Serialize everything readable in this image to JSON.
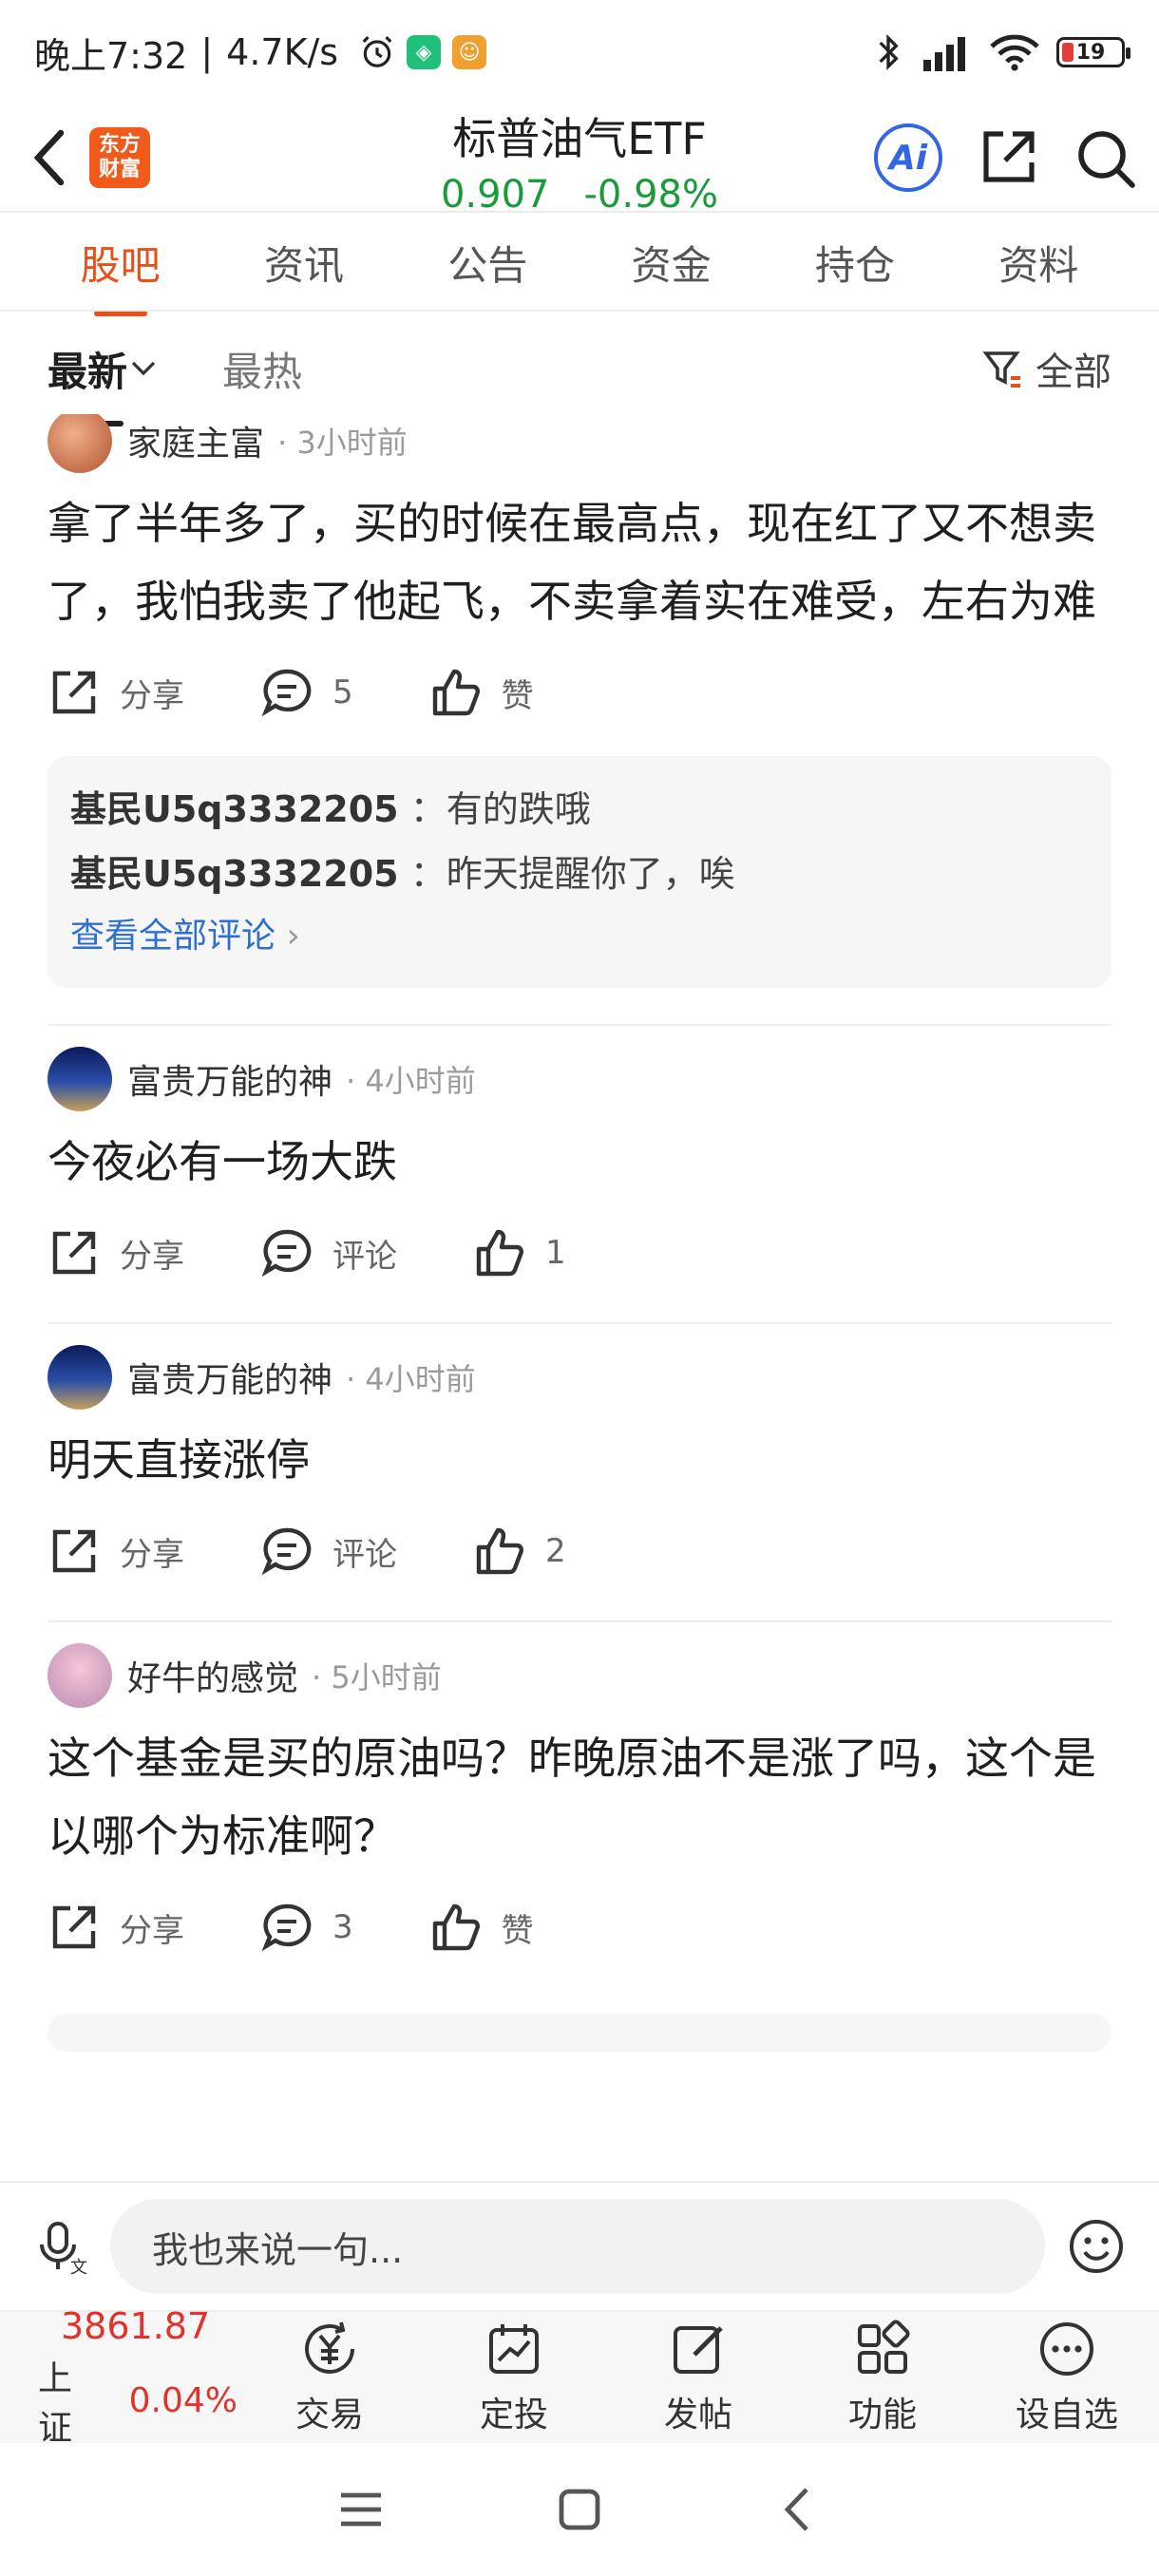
{
  "status_bar": {
    "time": "晚上7:32",
    "speed": "4.7K/s",
    "battery": "19"
  },
  "header": {
    "logo_line1": "东方",
    "logo_line2": "财富",
    "title": "标普油气ETF",
    "price": "0.907",
    "change": "-0.98%",
    "ai_label": "Ai"
  },
  "tabs": [
    "股吧",
    "资讯",
    "公告",
    "资金",
    "持仓",
    "资料"
  ],
  "filter": {
    "latest": "最新",
    "hottest": "最热",
    "all": "全部"
  },
  "posts": [
    {
      "user": "家庭主富",
      "time": "3小时前",
      "body": "拿了半年多了，买的时候在最高点，现在红了又不想卖了，我怕我卖了他起飞，不卖拿着实在难受，左右为难",
      "share": "分享",
      "comments": "5",
      "likes": "赞",
      "replies": [
        {
          "user": "基民U5q3332205",
          "text": "：有的跌哦"
        },
        {
          "user": "基民U5q3332205",
          "text": "：昨天提醒你了，唉"
        }
      ],
      "view_all": "查看全部评论"
    },
    {
      "user": "富贵万能的神",
      "time": "4小时前",
      "body": "今夜必有一场大跌",
      "share": "分享",
      "comments": "评论",
      "likes": "1"
    },
    {
      "user": "富贵万能的神",
      "time": "4小时前",
      "body": "明天直接涨停",
      "share": "分享",
      "comments": "评论",
      "likes": "2"
    },
    {
      "user": "好牛的感觉",
      "time": "5小时前",
      "body": "这个基金是买的原油吗？昨晚原油不是涨了吗，这个是以哪个为标准啊？",
      "share": "分享",
      "comments": "3",
      "likes": "赞"
    }
  ],
  "input": {
    "placeholder": "我也来说一句..."
  },
  "bottom_nav": {
    "index_value": "3861.87",
    "index_name": "上证",
    "index_change": "0.04%",
    "items": [
      "交易",
      "定投",
      "发帖",
      "功能",
      "设自选"
    ]
  },
  "colors": {
    "accent": "#e8501a",
    "up": "#e2322b",
    "down": "#1a9a3a",
    "link": "#2f6fd1"
  }
}
